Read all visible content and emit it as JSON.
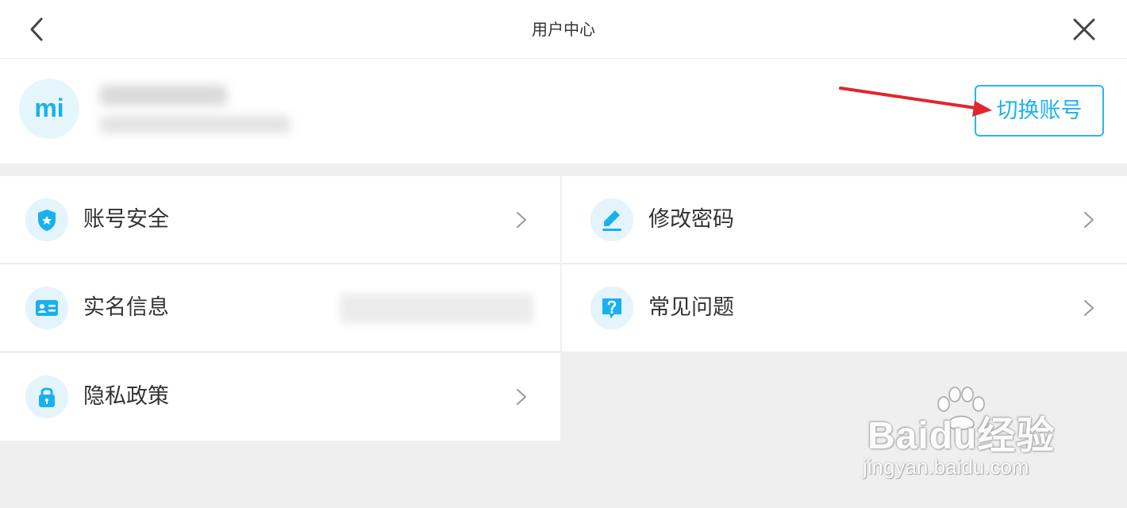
{
  "header": {
    "title": "用户中心",
    "back_icon": "chevron-left-icon",
    "close_icon": "close-icon"
  },
  "profile": {
    "avatar_text": "mi",
    "name": "",
    "account_id": "",
    "switch_label": "切换账号"
  },
  "menu": [
    {
      "label": "账号安全",
      "icon": "shield-star-icon",
      "value": ""
    },
    {
      "label": "修改密码",
      "icon": "pencil-icon",
      "value": ""
    },
    {
      "label": "实名信息",
      "icon": "id-card-icon",
      "value": ""
    },
    {
      "label": "常见问题",
      "icon": "question-icon",
      "value": ""
    },
    {
      "label": "隐私政策",
      "icon": "lock-icon",
      "value": ""
    }
  ],
  "watermark": {
    "main": "Baidu经验",
    "sub": "jingyan.baidu.com"
  },
  "colors": {
    "accent": "#1fb1ec",
    "icon_bg": "#e4f4fc",
    "annotation_arrow": "#e0262e",
    "page_bg": "#efefef"
  }
}
